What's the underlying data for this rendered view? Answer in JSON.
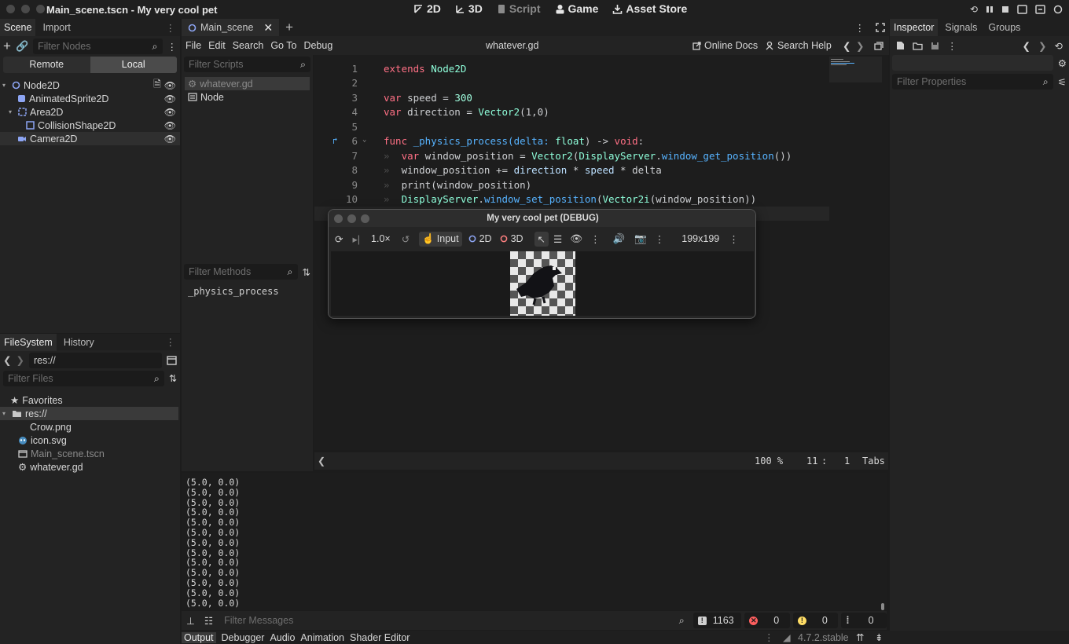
{
  "window": {
    "title": "Main_scene.tscn - My very cool pet",
    "modes": [
      {
        "label": "2D",
        "icon": "2d-icon"
      },
      {
        "label": "3D",
        "icon": "3d-icon"
      },
      {
        "label": "Script",
        "icon": "script-icon"
      },
      {
        "label": "Game",
        "icon": "game-icon"
      },
      {
        "label": "Asset Store",
        "icon": "asset-store-icon"
      }
    ]
  },
  "scene_dock": {
    "tabs": [
      "Scene",
      "Import"
    ],
    "filter_placeholder": "Filter Nodes",
    "remote_label": "Remote",
    "local_label": "Local",
    "nodes": [
      "Node2D",
      "AnimatedSprite2D",
      "Area2D",
      "CollisionShape2D",
      "Camera2D"
    ]
  },
  "filesystem_dock": {
    "tabs": [
      "FileSystem",
      "History"
    ],
    "path": "res://",
    "filter_placeholder": "Filter Files",
    "favorites_label": "Favorites",
    "root_label": "res://",
    "files": [
      "Crow.png",
      "icon.svg",
      "Main_scene.tscn",
      "whatever.gd"
    ]
  },
  "editor_tabs": {
    "active_tab": "Main_scene"
  },
  "script_editor": {
    "menu": [
      "File",
      "Edit",
      "Search",
      "Go To",
      "Debug"
    ],
    "current_file": "whatever.gd",
    "online_docs_label": "Online Docs",
    "search_help_label": "Search Help",
    "filter_scripts_placeholder": "Filter Scripts",
    "scripts": [
      "whatever.gd",
      "Node"
    ],
    "filter_methods_placeholder": "Filter Methods",
    "methods": [
      "_physics_process"
    ],
    "zoom": "100 %",
    "line": "11",
    "col": "1",
    "indent_mode": "Tabs"
  },
  "code": {
    "line_numbers": [
      "1",
      "2",
      "3",
      "4",
      "5",
      "6",
      "7",
      "8",
      "9",
      "10"
    ],
    "l1_kw": "extends",
    "l1_type": "Node2D",
    "l3_kw": "var",
    "l3_rest": " speed = ",
    "l3_num": "300",
    "l4_kw": "var",
    "l4_rest": " direction = ",
    "l4_type": "Vector2",
    "l4_args": "(1,0)",
    "l6_kw": "func",
    "l6_name": " _physics_process(delta: ",
    "l6_type": "float",
    "l6_rest": ") -> ",
    "l6_void": "void",
    "l6_end": ":",
    "l7_kw": "var",
    "l7_a": " window_position = ",
    "l7_type": "Vector2",
    "l7_b": "(",
    "l7_class": "DisplayServer",
    "l7_dot": ".",
    "l7_fn": "window_get_position",
    "l7_end": "())",
    "l8": "window_position += ",
    "l8_dir": "direction",
    "l8_b": " * ",
    "l8_speed": "speed",
    "l8_c": " * delta",
    "l9": "print(window_position)",
    "l10_class": "DisplayServer",
    "l10_dot": ".",
    "l10_fn": "window_set_position",
    "l10_a": "(",
    "l10_type": "Vector2i",
    "l10_end": "(window_position))"
  },
  "game_window": {
    "title": "My very cool pet (DEBUG)",
    "speed": "1.0×",
    "input_label": "Input",
    "mode_2d": "2D",
    "mode_3d": "3D",
    "size": "199x199"
  },
  "output": {
    "lines": [
      "(5.0, 0.0)",
      "(5.0, 0.0)",
      "(5.0, 0.0)",
      "(5.0, 0.0)",
      "(5.0, 0.0)",
      "(5.0, 0.0)",
      "(5.0, 0.0)",
      "(5.0, 0.0)",
      "(5.0, 0.0)",
      "(5.0, 0.0)",
      "(5.0, 0.0)",
      "(5.0, 0.0)",
      "(5.0, 0.0)"
    ],
    "filter_placeholder": "Filter Messages",
    "count_messages": "1163",
    "count_errors": "0",
    "count_warnings": "0",
    "count_info": "0"
  },
  "bottom_tabs": [
    "Output",
    "Debugger",
    "Audio",
    "Animation",
    "Shader Editor"
  ],
  "version": "4.7.2.stable",
  "inspector": {
    "tabs": [
      "Inspector",
      "Signals",
      "Groups"
    ],
    "filter_placeholder": "Filter Properties"
  },
  "colors": {
    "accent": "#57b3ff",
    "node_blue": "#8da5f3",
    "error": "#ff5f5f",
    "warning": "#ffdd65"
  }
}
